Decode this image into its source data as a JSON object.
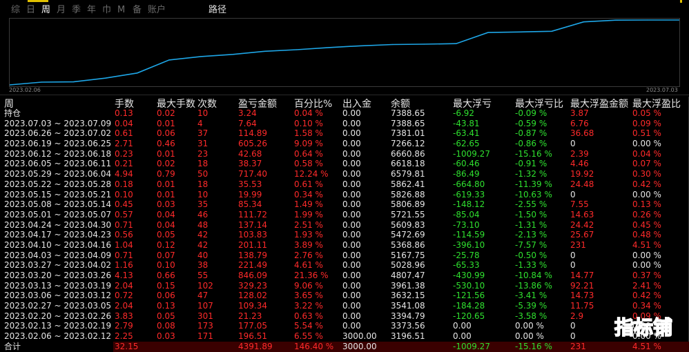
{
  "tabs": [
    {
      "label": "综"
    },
    {
      "label": "日"
    },
    {
      "label": "周"
    },
    {
      "label": "月"
    },
    {
      "label": "季"
    },
    {
      "label": "年"
    },
    {
      "label": "巾"
    },
    {
      "label": "M"
    },
    {
      "label": "备"
    },
    {
      "label": "账户"
    }
  ],
  "active_tab": "周",
  "path_label": "路径",
  "chart": {
    "start_label": "2023.02.06",
    "end_label": "2023.07.03",
    "line_color": "#1ea7e8",
    "values": [
      3196.51,
      3373.56,
      3394.79,
      3632.15,
      3961.38,
      4807.47,
      5028.96,
      5167.75,
      5368.86,
      5472.69,
      5609.83,
      5721.55,
      5806.89,
      5826.88,
      5862.41,
      6579.81,
      6618.18,
      6660.86,
      7266.12,
      7381.01,
      7388.65,
      7388.65
    ]
  },
  "columns": [
    "周",
    "手数",
    "最大手数",
    "次数",
    "盈亏金额",
    "百分比%",
    "出入金",
    "余额",
    "最大浮亏",
    "最大浮亏比",
    "最大浮盈金额",
    "最大浮盈比"
  ],
  "colors": {
    "red": "#ff2a2a",
    "green": "#2fe02f",
    "white": "#e6e6e6"
  },
  "rows": [
    {
      "week": "持仓",
      "lots": "0.13",
      "max_lots": "0.02",
      "count": "10",
      "pnl": "3.24",
      "pct": "0.04 %",
      "io": "0.00",
      "balance": "7388.65",
      "max_dd": "-6.92",
      "max_dd_pct": "-0.09 %",
      "max_fp": "3.87",
      "max_fp_pct": "0.05 %",
      "fp_red": true
    },
    {
      "week": "2023.07.03 ~ 2023.07.09",
      "lots": "0.04",
      "max_lots": "0.01",
      "count": "4",
      "pnl": "7.64",
      "pct": "0.10 %",
      "io": "0.00",
      "balance": "7388.65",
      "max_dd": "-43.81",
      "max_dd_pct": "-0.59 %",
      "max_fp": "6.76",
      "max_fp_pct": "0.09 %",
      "fp_red": true
    },
    {
      "week": "2023.06.26 ~ 2023.07.02",
      "lots": "0.61",
      "max_lots": "0.06",
      "count": "37",
      "pnl": "114.89",
      "pct": "1.58 %",
      "io": "0.00",
      "balance": "7381.01",
      "max_dd": "-63.41",
      "max_dd_pct": "-0.87 %",
      "max_fp": "36.68",
      "max_fp_pct": "0.51 %",
      "fp_red": true
    },
    {
      "week": "2023.06.19 ~ 2023.06.25",
      "lots": "2.71",
      "max_lots": "0.46",
      "count": "31",
      "pnl": "605.26",
      "pct": "9.09 %",
      "io": "0.00",
      "balance": "7266.12",
      "max_dd": "-62.65",
      "max_dd_pct": "-0.86 %",
      "max_fp": "0",
      "max_fp_pct": "0.00 %",
      "fp_red": false
    },
    {
      "week": "2023.06.12 ~ 2023.06.18",
      "lots": "0.23",
      "max_lots": "0.01",
      "count": "23",
      "pnl": "42.68",
      "pct": "0.64 %",
      "io": "0.00",
      "balance": "6660.86",
      "max_dd": "-1009.27",
      "max_dd_pct": "-15.16 %",
      "max_fp": "2.39",
      "max_fp_pct": "0.04 %",
      "fp_red": true
    },
    {
      "week": "2023.06.05 ~ 2023.06.11",
      "lots": "0.21",
      "max_lots": "0.02",
      "count": "18",
      "pnl": "38.37",
      "pct": "0.58 %",
      "io": "0.00",
      "balance": "6618.18",
      "max_dd": "-60.46",
      "max_dd_pct": "-0.91 %",
      "max_fp": "4.46",
      "max_fp_pct": "0.07 %",
      "fp_red": true
    },
    {
      "week": "2023.05.29 ~ 2023.06.04",
      "lots": "4.94",
      "max_lots": "0.79",
      "count": "50",
      "pnl": "717.40",
      "pct": "12.24 %",
      "io": "0.00",
      "balance": "6579.81",
      "max_dd": "-86.49",
      "max_dd_pct": "-1.32 %",
      "max_fp": "19.92",
      "max_fp_pct": "0.30 %",
      "fp_red": true
    },
    {
      "week": "2023.05.22 ~ 2023.05.28",
      "lots": "0.18",
      "max_lots": "0.01",
      "count": "18",
      "pnl": "35.53",
      "pct": "0.61 %",
      "io": "0.00",
      "balance": "5862.41",
      "max_dd": "-664.80",
      "max_dd_pct": "-11.39 %",
      "max_fp": "24.48",
      "max_fp_pct": "0.42 %",
      "fp_red": true
    },
    {
      "week": "2023.05.15 ~ 2023.05.21",
      "lots": "0.10",
      "max_lots": "0.01",
      "count": "10",
      "pnl": "19.99",
      "pct": "0.34 %",
      "io": "0.00",
      "balance": "5826.88",
      "max_dd": "-619.33",
      "max_dd_pct": "-10.63 %",
      "max_fp": "0",
      "max_fp_pct": "0.00 %",
      "fp_red": false
    },
    {
      "week": "2023.05.08 ~ 2023.05.14",
      "lots": "0.45",
      "max_lots": "0.03",
      "count": "35",
      "pnl": "85.34",
      "pct": "1.49 %",
      "io": "0.00",
      "balance": "5806.89",
      "max_dd": "-148.12",
      "max_dd_pct": "-2.55 %",
      "max_fp": "7.55",
      "max_fp_pct": "0.13 %",
      "fp_red": true
    },
    {
      "week": "2023.05.01 ~ 2023.05.07",
      "lots": "0.57",
      "max_lots": "0.04",
      "count": "46",
      "pnl": "111.72",
      "pct": "1.99 %",
      "io": "0.00",
      "balance": "5721.55",
      "max_dd": "-85.04",
      "max_dd_pct": "-1.50 %",
      "max_fp": "14.63",
      "max_fp_pct": "0.26 %",
      "fp_red": true
    },
    {
      "week": "2023.04.24 ~ 2023.04.30",
      "lots": "0.71",
      "max_lots": "0.04",
      "count": "48",
      "pnl": "137.14",
      "pct": "2.51 %",
      "io": "0.00",
      "balance": "5609.83",
      "max_dd": "-73.10",
      "max_dd_pct": "-1.31 %",
      "max_fp": "24.42",
      "max_fp_pct": "0.45 %",
      "fp_red": true
    },
    {
      "week": "2023.04.17 ~ 2023.04.23",
      "lots": "0.56",
      "max_lots": "0.05",
      "count": "42",
      "pnl": "103.83",
      "pct": "1.93 %",
      "io": "0.00",
      "balance": "5472.69",
      "max_dd": "-114.59",
      "max_dd_pct": "-2.13 %",
      "max_fp": "25.67",
      "max_fp_pct": "0.48 %",
      "fp_red": true
    },
    {
      "week": "2023.04.10 ~ 2023.04.16",
      "lots": "1.04",
      "max_lots": "0.12",
      "count": "42",
      "pnl": "201.11",
      "pct": "3.89 %",
      "io": "0.00",
      "balance": "5368.86",
      "max_dd": "-396.10",
      "max_dd_pct": "-7.57 %",
      "max_fp": "231",
      "max_fp_pct": "4.51 %",
      "fp_red": true
    },
    {
      "week": "2023.04.03 ~ 2023.04.09",
      "lots": "0.71",
      "max_lots": "0.07",
      "count": "40",
      "pnl": "138.79",
      "pct": "2.76 %",
      "io": "0.00",
      "balance": "5167.75",
      "max_dd": "-25.78",
      "max_dd_pct": "-0.50 %",
      "max_fp": "0",
      "max_fp_pct": "0.00 %",
      "fp_red": false
    },
    {
      "week": "2023.03.27 ~ 2023.04.02",
      "lots": "1.16",
      "max_lots": "0.10",
      "count": "38",
      "pnl": "221.49",
      "pct": "4.61 %",
      "io": "0.00",
      "balance": "5028.96",
      "max_dd": "-65.33",
      "max_dd_pct": "-1.33 %",
      "max_fp": "0",
      "max_fp_pct": "0.00 %",
      "fp_red": false
    },
    {
      "week": "2023.03.20 ~ 2023.03.26",
      "lots": "4.13",
      "max_lots": "0.66",
      "count": "55",
      "pnl": "846.09",
      "pct": "21.36 %",
      "io": "0.00",
      "balance": "4807.47",
      "max_dd": "-430.99",
      "max_dd_pct": "-10.84 %",
      "max_fp": "14.77",
      "max_fp_pct": "0.37 %",
      "fp_red": true
    },
    {
      "week": "2023.03.13 ~ 2023.03.19",
      "lots": "2.04",
      "max_lots": "0.15",
      "count": "102",
      "pnl": "329.23",
      "pct": "9.06 %",
      "io": "0.00",
      "balance": "3961.38",
      "max_dd": "-530.10",
      "max_dd_pct": "-13.86 %",
      "max_fp": "92.21",
      "max_fp_pct": "2.41 %",
      "fp_red": true
    },
    {
      "week": "2023.03.06 ~ 2023.03.12",
      "lots": "0.72",
      "max_lots": "0.06",
      "count": "47",
      "pnl": "128.02",
      "pct": "3.65 %",
      "io": "0.00",
      "balance": "3632.15",
      "max_dd": "-121.56",
      "max_dd_pct": "-3.41 %",
      "max_fp": "14.73",
      "max_fp_pct": "0.42 %",
      "fp_red": true
    },
    {
      "week": "2023.02.27 ~ 2023.03.05",
      "lots": "2.04",
      "max_lots": "0.13",
      "count": "107",
      "pnl": "109.34",
      "pct": "3.22 %",
      "io": "0.00",
      "balance": "3541.08",
      "max_dd": "-184.28",
      "max_dd_pct": "-5.39 %",
      "max_fp": "11.75",
      "max_fp_pct": "0.34 %",
      "fp_red": true
    },
    {
      "week": "2023.02.20 ~ 2023.02.26",
      "lots": "3.83",
      "max_lots": "0.05",
      "count": "301",
      "pnl": "21.23",
      "pct": "0.63 %",
      "io": "0.00",
      "balance": "3394.79",
      "max_dd": "-120.65",
      "max_dd_pct": "-3.58 %",
      "max_fp": "2.9",
      "max_fp_pct": "0.09 %",
      "fp_red": true
    },
    {
      "week": "2023.02.13 ~ 2023.02.19",
      "lots": "2.79",
      "max_lots": "0.08",
      "count": "173",
      "pnl": "177.05",
      "pct": "5.54 %",
      "io": "0.00",
      "balance": "3373.56",
      "max_dd": "0.00",
      "max_dd_pct": "0.00 %",
      "max_fp": "0",
      "max_fp_pct": "0.00 %",
      "fp_red": false
    },
    {
      "week": "2023.02.06 ~ 2023.02.12",
      "lots": "2.25",
      "max_lots": "0.03",
      "count": "171",
      "pnl": "196.51",
      "pct": "6.55 %",
      "io": "3000.00",
      "balance": "3196.51",
      "max_dd": "0.00",
      "max_dd_pct": "0.00 %",
      "max_fp": "0",
      "max_fp_pct": "0.00 %",
      "fp_red": false
    }
  ],
  "total": {
    "label": "合计",
    "lots": "32.15",
    "pnl": "4391.89",
    "pct": "146.40 %",
    "io": "3000.00",
    "max_dd": "-1009.27",
    "max_dd_pct": "-15.16 %",
    "max_fp": "231",
    "max_fp_pct": "4.51 %"
  },
  "watermark": "指标铺"
}
